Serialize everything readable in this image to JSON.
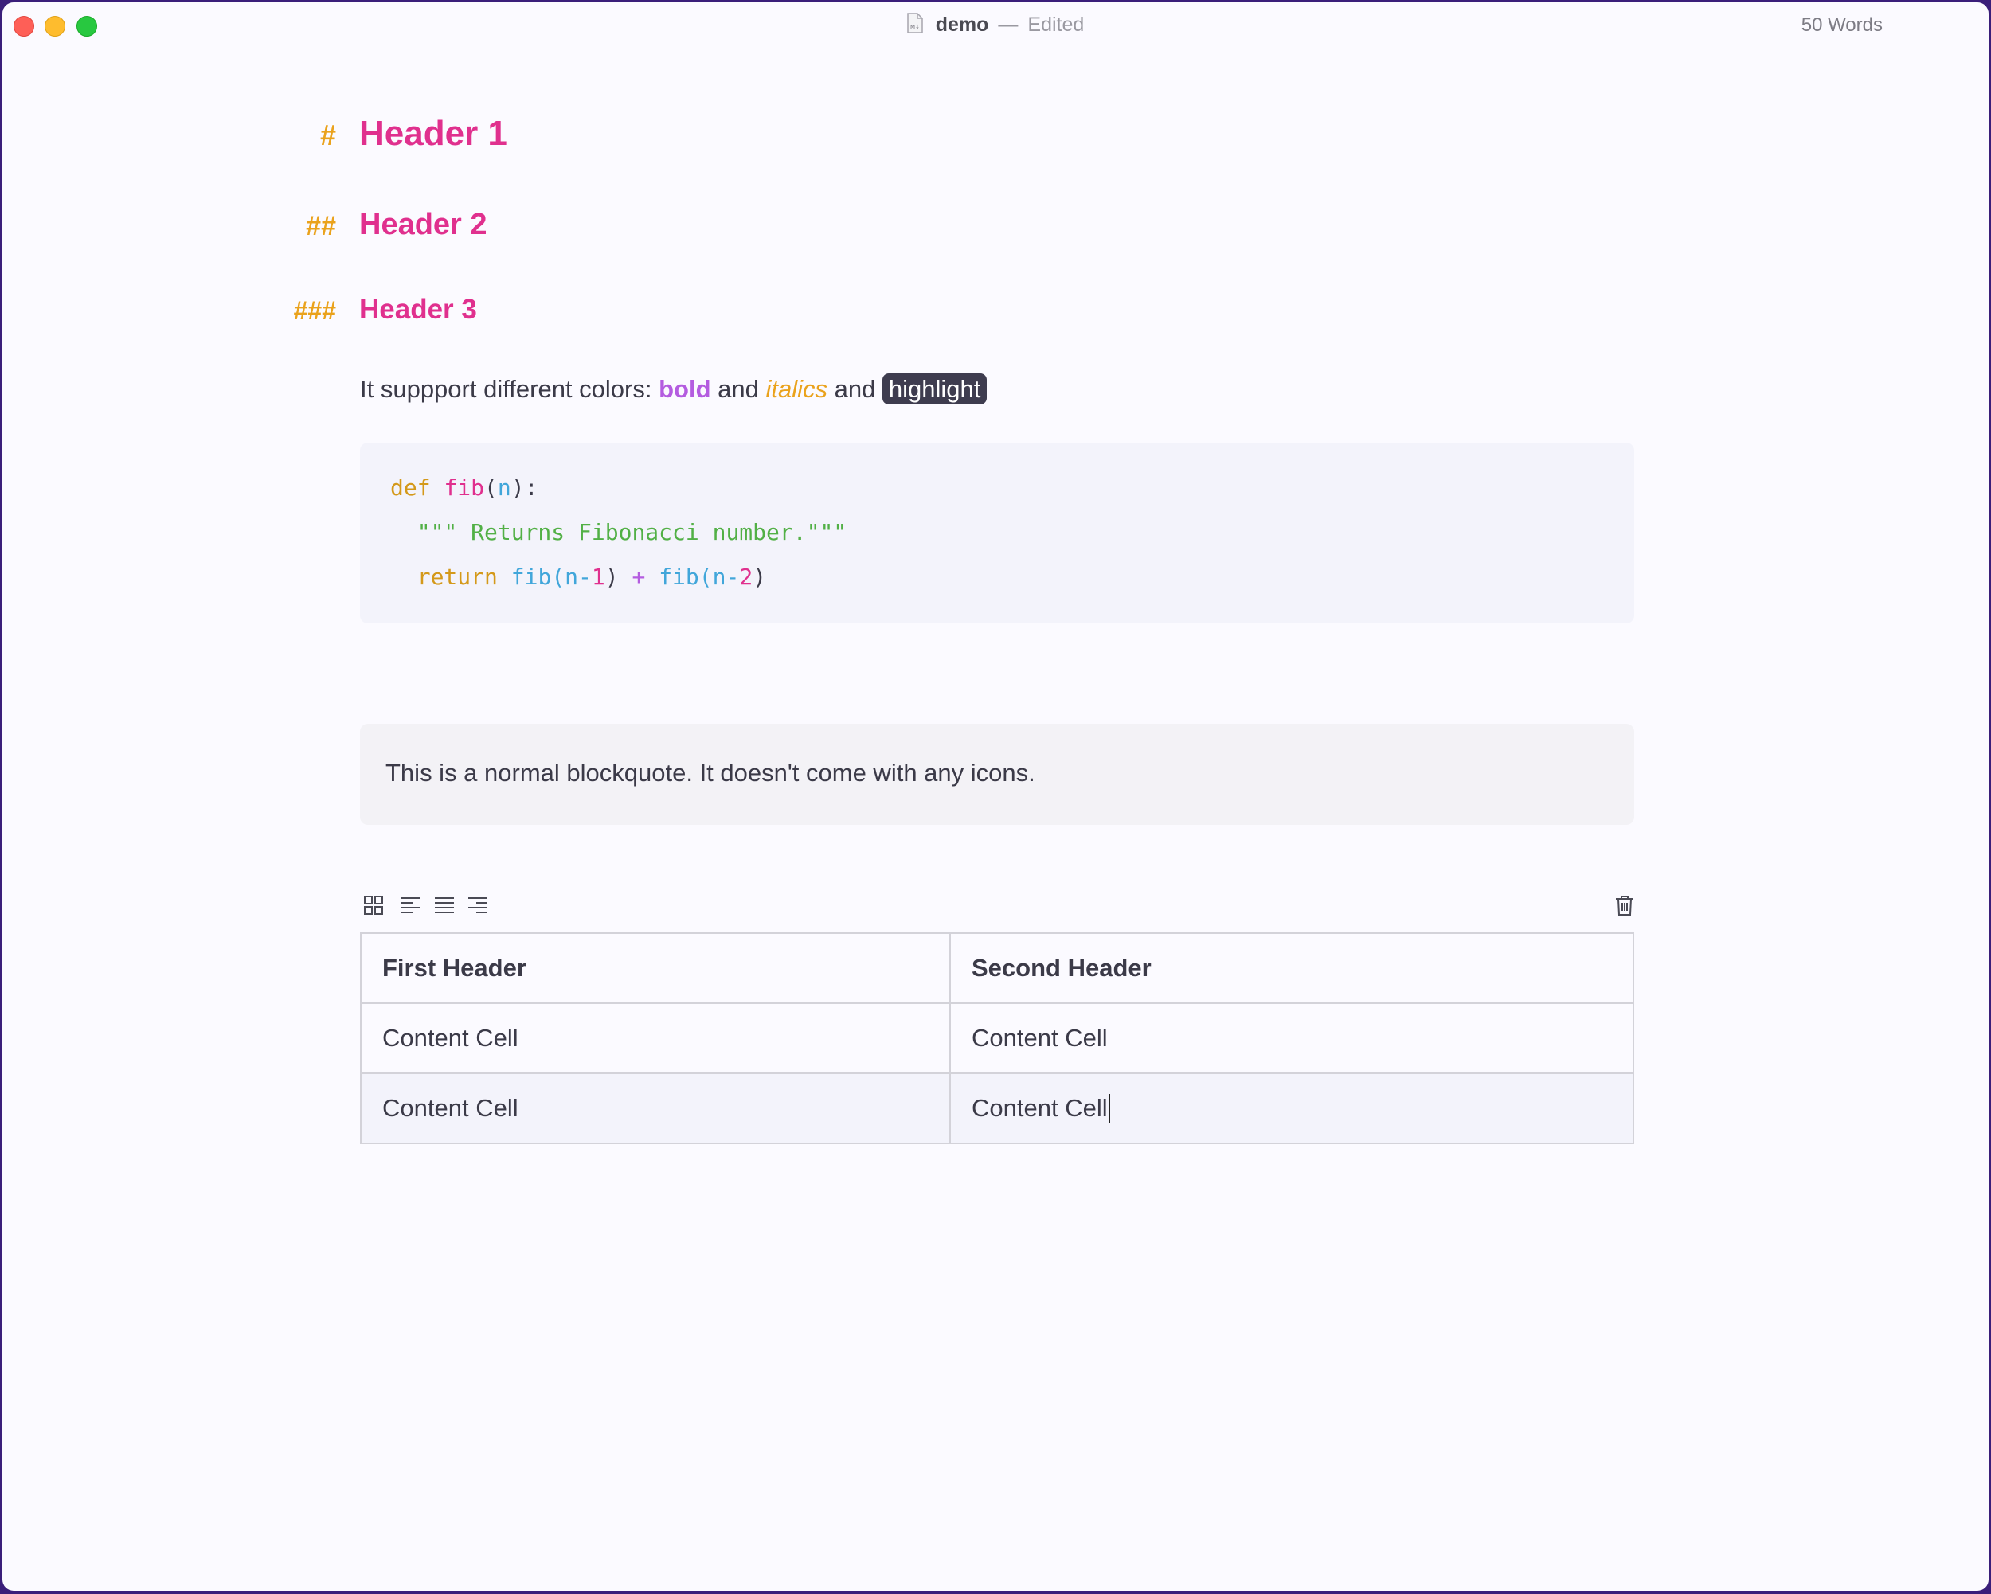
{
  "window": {
    "title": "demo",
    "separator": "—",
    "status": "Edited",
    "word_count": "50 Words"
  },
  "headers": [
    {
      "marker": "#",
      "text": "Header 1"
    },
    {
      "marker": "##",
      "text": "Header 2"
    },
    {
      "marker": "###",
      "text": "Header 3"
    }
  ],
  "paragraph": {
    "prefix": "It suppport different colors: ",
    "bold": "bold",
    "and1": " and ",
    "italic": "italics",
    "and2": " and ",
    "highlight": "highlight"
  },
  "code": {
    "line1": {
      "kw": "def",
      "fn": "fib",
      "open": "(",
      "param": "n",
      "close": "):"
    },
    "line2": {
      "doc": "\"\"\" Returns Fibonacci number.\"\"\""
    },
    "line3": {
      "kw": "return",
      "f1": "fib",
      "a1": "(n-",
      "n1": "1",
      "c1": ")",
      "plus": "+",
      "f2": "fib",
      "a2": "(n-",
      "n2": "2",
      "c2": ")"
    }
  },
  "blockquote": "This is a normal blockquote. It doesn't come with any icons.",
  "table": {
    "headers": [
      "First Header",
      "Second Header"
    ],
    "rows": [
      [
        "Content Cell",
        "Content Cell"
      ],
      [
        "Content Cell",
        "Content Cell"
      ]
    ]
  },
  "colors": {
    "heading": "#e0308e",
    "heading_marker": "#eaa21c",
    "bold": "#b45ce0",
    "italic": "#eaa21c",
    "highlight_bg": "#3e3c4f",
    "code_string": "#52b046"
  },
  "icons": [
    "document-icon",
    "table-grid-icon",
    "align-left-icon",
    "align-center-icon",
    "align-right-icon",
    "trash-icon"
  ]
}
